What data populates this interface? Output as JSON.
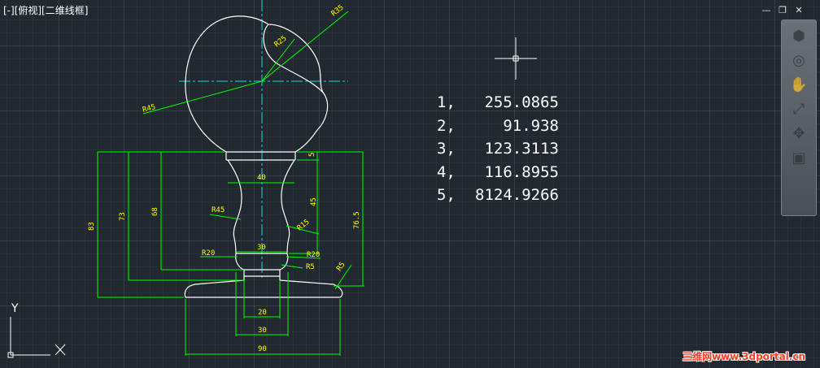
{
  "view": {
    "label": "[-][俯视][二维线框]"
  },
  "window_controls": {
    "minimize": "—",
    "restore": "❐",
    "close": "✕"
  },
  "dimensions": {
    "r35": "R35",
    "r25": "R25",
    "r45_top": "R45",
    "d5": "5",
    "d40": "40",
    "d45": "45",
    "r45_mid": "R45",
    "r15": "R15",
    "d30_top": "30",
    "r20_left": "R20",
    "r20_right": "R20",
    "r5_right": "R5",
    "r5_base": "R5",
    "d83": "83",
    "d73": "73",
    "d68": "68",
    "d765": "76.5",
    "d20": "20",
    "d30_bottom": "30",
    "d90": "90"
  },
  "coordinates": [
    {
      "index": "1,",
      "value": "255.0865"
    },
    {
      "index": "2,",
      "value": "91.938"
    },
    {
      "index": "3,",
      "value": "123.3113"
    },
    {
      "index": "4,",
      "value": "116.8955"
    },
    {
      "index": "5,",
      "value": "8124.9266"
    }
  ],
  "ucs": {
    "y_label": "Y",
    "x_label": "X"
  },
  "navbar": {
    "items": [
      "viewcube-icon",
      "steering-wheel-icon",
      "pan-hand-icon",
      "zoom-icon",
      "orbit-icon",
      "showmotion-icon"
    ]
  },
  "watermark": "三维网www.3dportal.cn",
  "colors": {
    "background": "#212830",
    "object": "#ffffff",
    "dimension": "#00ff00",
    "dimension_text": "#ffff00",
    "centerline": "#00e5e5"
  }
}
